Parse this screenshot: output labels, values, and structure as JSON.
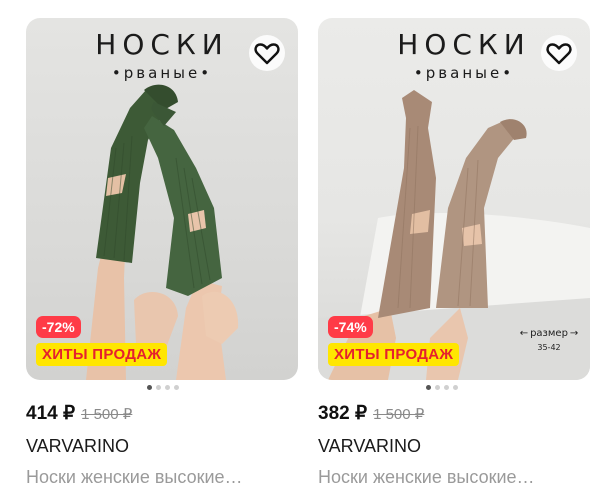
{
  "products": [
    {
      "brand_main": "НОСКИ",
      "brand_sub": "•рваные•",
      "discount": "-72%",
      "promo": "ХИТЫ ПРОДАЖ",
      "price": "414 ₽",
      "old_price": "1 500 ₽",
      "seller": "VARVARINO",
      "title": "Носки женские высокие…",
      "sock_color": "#3d5a36",
      "carousel_dots": 4,
      "carousel_active": 0
    },
    {
      "brand_main": "НОСКИ",
      "brand_sub": "•рваные•",
      "discount": "-74%",
      "promo": "ХИТЫ ПРОДАЖ",
      "price": "382 ₽",
      "old_price": "1 500 ₽",
      "seller": "VARVARINO",
      "title": "Носки женские высокие…",
      "size_label": "размер",
      "size_range": "35-42",
      "sock_color": "#a88a76",
      "carousel_dots": 4,
      "carousel_active": 0
    }
  ],
  "icons": {
    "favorite": "heart-icon"
  },
  "colors": {
    "discount_bg": "#ff3b47",
    "promo_bg": "#ffe600",
    "promo_text": "#e5202e"
  }
}
